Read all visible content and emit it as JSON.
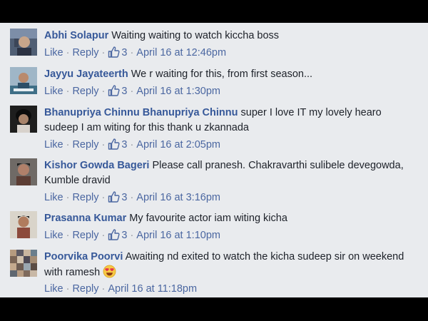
{
  "comments": [
    {
      "author": "Abhi Solapur",
      "text": "Waiting waiting to watch kiccha boss",
      "like_label": "Like",
      "reply_label": "Reply",
      "likes": "3",
      "timestamp": "April 16 at 12:46pm"
    },
    {
      "author": "Jayyu Jayateerth",
      "text": "We r waiting for this, from first season...",
      "like_label": "Like",
      "reply_label": "Reply",
      "likes": "3",
      "timestamp": "April 16 at 1:30pm"
    },
    {
      "author": "Bhanupriya Chinnu Bhanupriya Chinnu",
      "text": "super I love IT my lovely hearo sudeep I am witing for this thank u zkannada",
      "like_label": "Like",
      "reply_label": "Reply",
      "likes": "3",
      "timestamp": "April 16 at 2:05pm"
    },
    {
      "author": "Kishor Gowda Bageri",
      "text": "Please call pranesh. Chakravarthi sulibele devegowda, Kumble dravid",
      "like_label": "Like",
      "reply_label": "Reply",
      "likes": "3",
      "timestamp": "April 16 at 3:16pm"
    },
    {
      "author": "Prasanna Kumar",
      "text": "My favourite actor iam witing kicha",
      "like_label": "Like",
      "reply_label": "Reply",
      "likes": "3",
      "timestamp": "April 16 at 1:10pm"
    },
    {
      "author": "Poorvika Poorvi",
      "text": "Awaiting nd exited to watch the kicha sudeep sir on weekend with ramesh",
      "like_label": "Like",
      "reply_label": "Reply",
      "timestamp": "April 16 at 11:18pm",
      "emoji": "heart-eyes-emoji"
    }
  ],
  "separator": "·",
  "icons": {
    "like": "thumbs-up-icon"
  },
  "colors": {
    "background": "#e9ebee",
    "author": "#365899",
    "link": "#4b67a1",
    "meta": "#90949c",
    "text": "#1d2129",
    "letterbox": "#000000"
  }
}
